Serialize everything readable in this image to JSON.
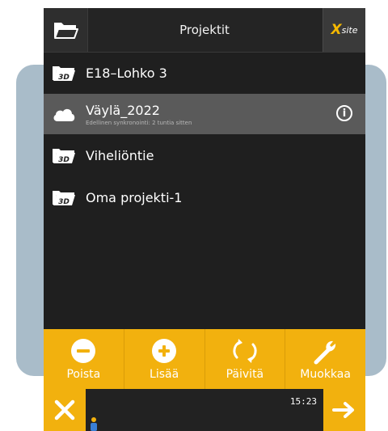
{
  "header": {
    "title": "Projektit",
    "logo_x": "X",
    "logo_site": "site",
    "folder_icon": "folder-open-icon"
  },
  "projects": [
    {
      "name": "E18–Lohko 3",
      "icon": "3d-folder-icon"
    },
    {
      "name": "Väylä_2022",
      "subtitle": "Edellinen synkronointi: 2 tuntia sitten",
      "icon": "cloud-icon",
      "selected": true
    },
    {
      "name": "Viheliöntie",
      "icon": "3d-folder-icon"
    },
    {
      "name": "Oma projekti-1",
      "icon": "3d-folder-icon"
    }
  ],
  "folder_badge": "3D",
  "toolbar": {
    "delete_label": "Poista",
    "add_label": "Lisää",
    "refresh_label": "Päivitä",
    "edit_label": "Muokkaa"
  },
  "status": {
    "time": "15:23"
  },
  "colors": {
    "accent": "#f2b10e",
    "background": "#1f1f1f",
    "selected_row": "#5a5a5a",
    "frame": "#a9bcc9"
  }
}
